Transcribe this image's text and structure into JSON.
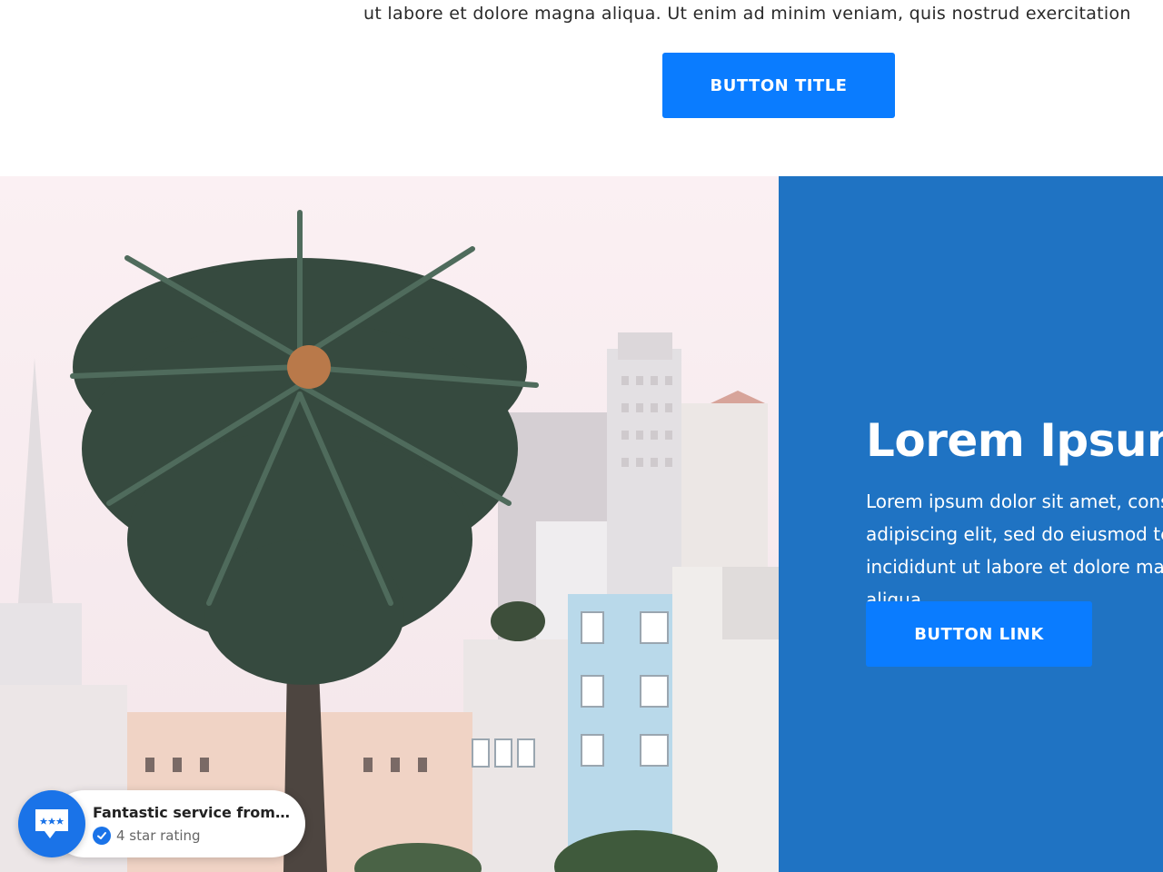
{
  "top": {
    "intro_text": "ut labore et dolore magna aliqua. Ut enim ad minim veniam, quis nostrud exercitation",
    "button_label": "BUTTON TITLE"
  },
  "feature": {
    "photo_alt": "",
    "title": "Lorem Ipsum",
    "body": "Lorem ipsum dolor sit amet, consectetur adipiscing elit, sed do eiusmod tempor incididunt ut labore et dolore magna aliqua.",
    "button_label": "BUTTON LINK"
  },
  "review_widget": {
    "title": "Fantastic service from Th...",
    "rating_text": "4 star rating",
    "icon": "chat-stars-icon",
    "verified_icon": "check-icon"
  },
  "colors": {
    "accent_button": "#0a7cff",
    "panel_background": "#1f73c3",
    "widget_accent": "#1a73e8"
  }
}
